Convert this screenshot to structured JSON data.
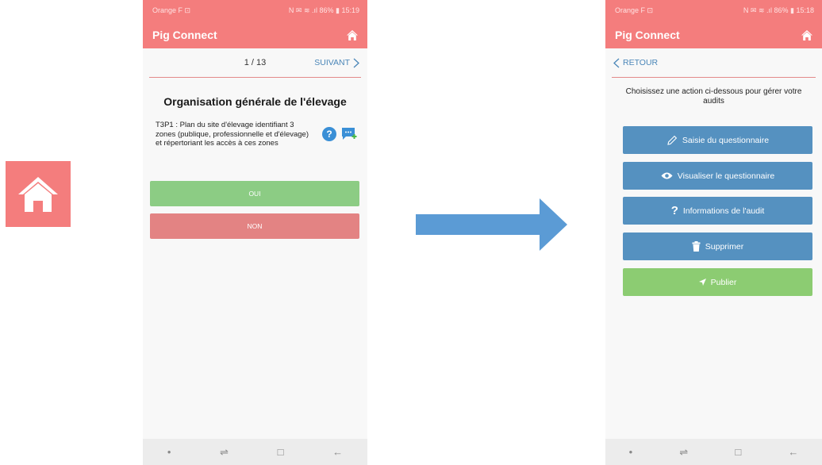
{
  "left_phone": {
    "status": {
      "carrier": "Orange F ⊡",
      "right": "N ✉ ≋ .ıl 86% ▮ 15:19"
    },
    "app_title": "Pig Connect",
    "pager": "1 / 13",
    "next_label": "SUIVANT",
    "section_title": "Organisation générale de l'élevage",
    "question": "T3P1 : Plan du site d'élevage identifiant 3 zones (publique, professionnelle et d'élevage) et répertoriant les accès à ces zones",
    "yes_label": "OUI",
    "no_label": "NON",
    "nav_dot": "•",
    "nav_recent": "⇌",
    "nav_home": "□",
    "nav_back": "←"
  },
  "right_phone": {
    "status": {
      "carrier": "Orange F ⊡",
      "right": "N ✉ ≋ .ıl 86% ▮ 15:18"
    },
    "app_title": "Pig Connect",
    "back_label": "RETOUR",
    "intro": "Choisissez une action ci-dessous pour gérer votre audits",
    "actions": {
      "edit": "Saisie du questionnaire",
      "view": "Visualiser le questionnaire",
      "info": "Informations de l'audit",
      "delete": "Supprimer",
      "publish": "Publier"
    },
    "nav_dot": "•",
    "nav_recent": "⇌",
    "nav_home": "□",
    "nav_back": "←"
  },
  "colors": {
    "brand_red": "#f47d7d",
    "action_blue": "#5591c0",
    "publish_green": "#8ccc72",
    "yes_green": "#8ccc84",
    "no_red": "#e38383",
    "arrow_blue": "#5b9bd5"
  }
}
